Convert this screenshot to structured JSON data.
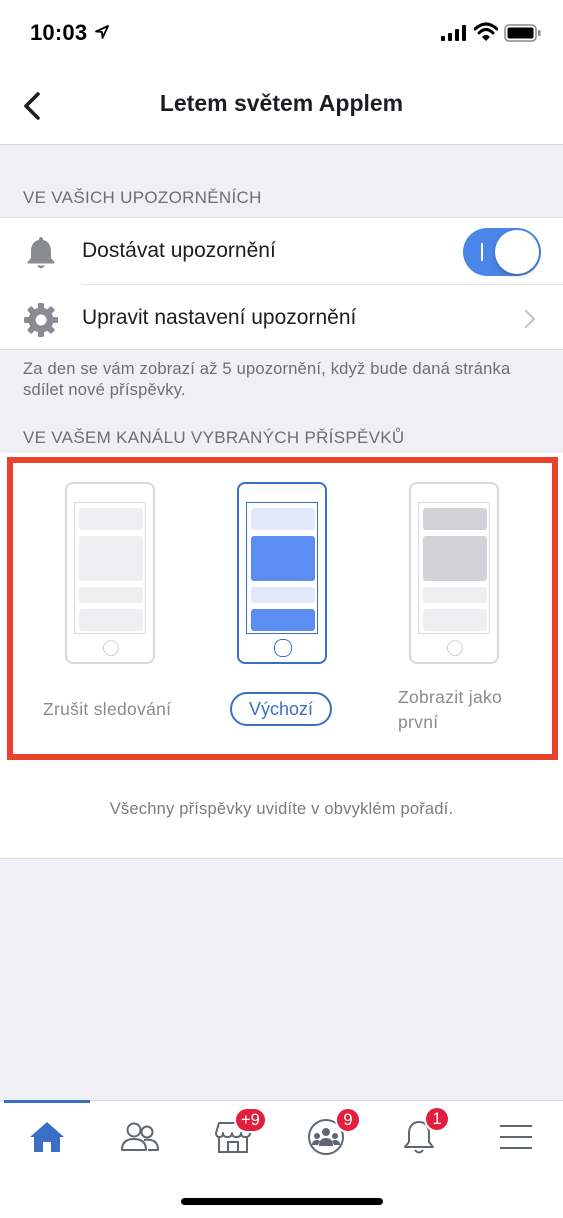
{
  "status_bar": {
    "time": "10:03"
  },
  "header": {
    "title": "Letem světem Applem"
  },
  "notifications_section": {
    "header": "VE VAŠICH UPOZORNĚNÍCH",
    "rows": [
      {
        "label": "Dostávat upozornění",
        "icon": "bell-icon",
        "toggle_on": true
      },
      {
        "label": "Upravit nastavení upozornění",
        "icon": "gear-icon"
      }
    ],
    "info": "Za den se vám zobrazí až 5 upozornění, když bude daná stránka sdílet nové příspěvky."
  },
  "feed_section": {
    "header": "VE VAŠEM KANÁLU VYBRANÝCH PŘÍSPĚVKŮ",
    "options": [
      {
        "label": "Zrušit sledování",
        "selected": false
      },
      {
        "label": "Výchozí",
        "selected": true
      },
      {
        "label": "Zobrazit jako první",
        "selected": false
      }
    ],
    "description": "Všechny příspěvky uvidíte v obvyklém pořadí."
  },
  "tab_bar": {
    "tabs": [
      {
        "icon": "home-icon",
        "active": true,
        "badge": ""
      },
      {
        "icon": "friends-icon",
        "active": false,
        "badge": ""
      },
      {
        "icon": "marketplace-icon",
        "active": false,
        "badge": "+9"
      },
      {
        "icon": "groups-icon",
        "active": false,
        "badge": "9"
      },
      {
        "icon": "notifications-icon",
        "active": false,
        "badge": "1"
      },
      {
        "icon": "menu-icon",
        "active": false,
        "badge": ""
      }
    ]
  },
  "colors": {
    "accent": "#3b6fc6",
    "toggle": "#4a86e8",
    "badge": "#e41e3f",
    "highlight": "#e8412c"
  }
}
